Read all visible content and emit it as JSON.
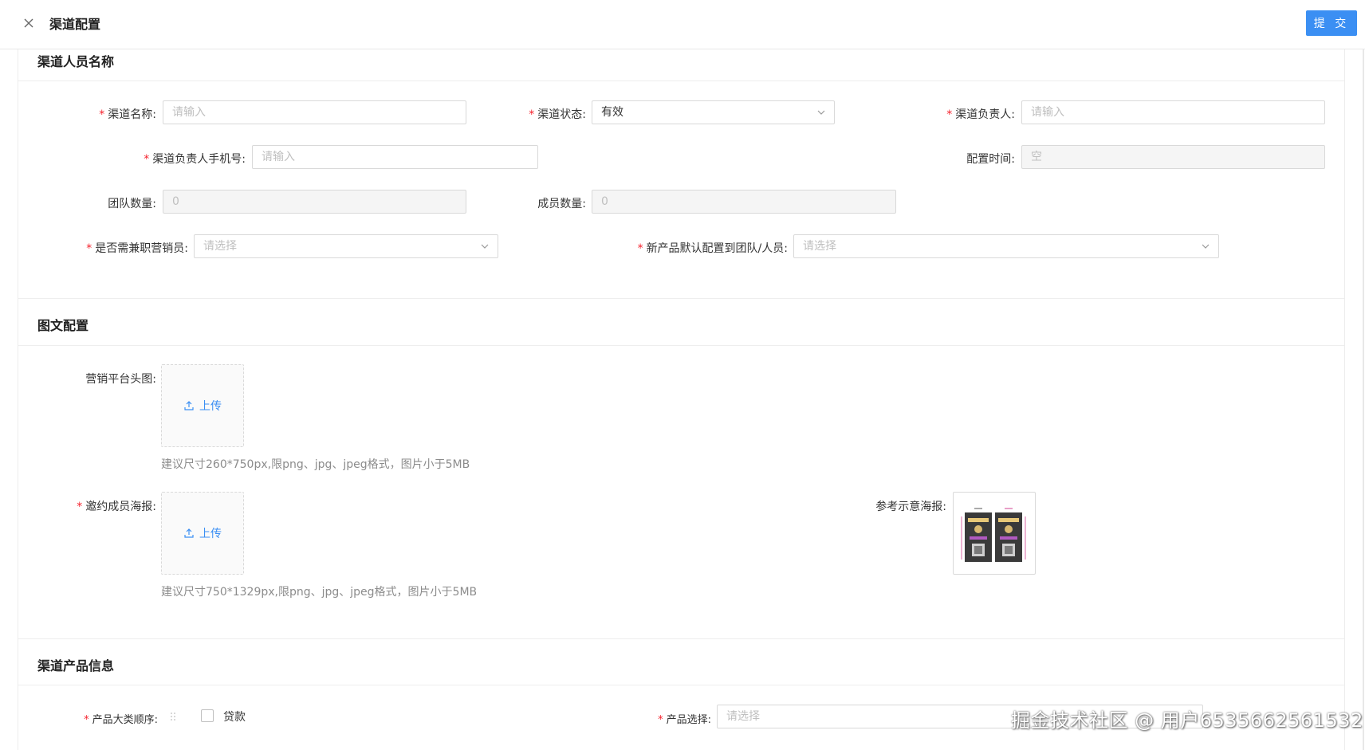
{
  "header": {
    "title": "渠道配置",
    "submit_label": "提 交"
  },
  "sections": {
    "personnel": {
      "title": "渠道人员名称",
      "fields": {
        "channel_name": {
          "label": "渠道名称:",
          "placeholder": "请输入"
        },
        "channel_status": {
          "label": "渠道状态:",
          "value": "有效"
        },
        "channel_owner": {
          "label": "渠道负责人:",
          "placeholder": "请输入"
        },
        "owner_phone": {
          "label": "渠道负责人手机号:",
          "placeholder": "请输入"
        },
        "config_time": {
          "label": "配置时间:",
          "placeholder": "空"
        },
        "team_count": {
          "label": "团队数量:",
          "placeholder": "0"
        },
        "member_count": {
          "label": "成员数量:",
          "placeholder": "0"
        },
        "need_part_time": {
          "label": "是否需兼职营销员:",
          "placeholder": "请选择"
        },
        "default_assign": {
          "label": "新产品默认配置到团队/人员:",
          "placeholder": "请选择"
        }
      }
    },
    "graphics": {
      "title": "图文配置",
      "avatar": {
        "label": "营销平台头图:",
        "upload_label": "上传",
        "hint": "建议尺寸260*750px,限png、jpg、jpeg格式，图片小于5MB"
      },
      "poster": {
        "label": "邀约成员海报:",
        "upload_label": "上传",
        "hint": "建议尺寸750*1329px,限png、jpg、jpeg格式，图片小于5MB"
      },
      "reference": {
        "label": "参考示意海报:"
      }
    },
    "products": {
      "title": "渠道产品信息",
      "category_order": {
        "label": "产品大类顺序:",
        "item": "贷款"
      },
      "product_select": {
        "label": "产品选择:",
        "placeholder": "请选择"
      }
    }
  },
  "watermark": "掘金技术社区 @ 用户6535662561532",
  "colors": {
    "primary": "#3b8ff3",
    "required": "#f5222d",
    "border": "#d9d9d9",
    "disabled_bg": "#f5f5f5"
  },
  "icons": [
    "close-icon",
    "chevron-down-icon",
    "upload-icon",
    "drag-handle-icon"
  ]
}
